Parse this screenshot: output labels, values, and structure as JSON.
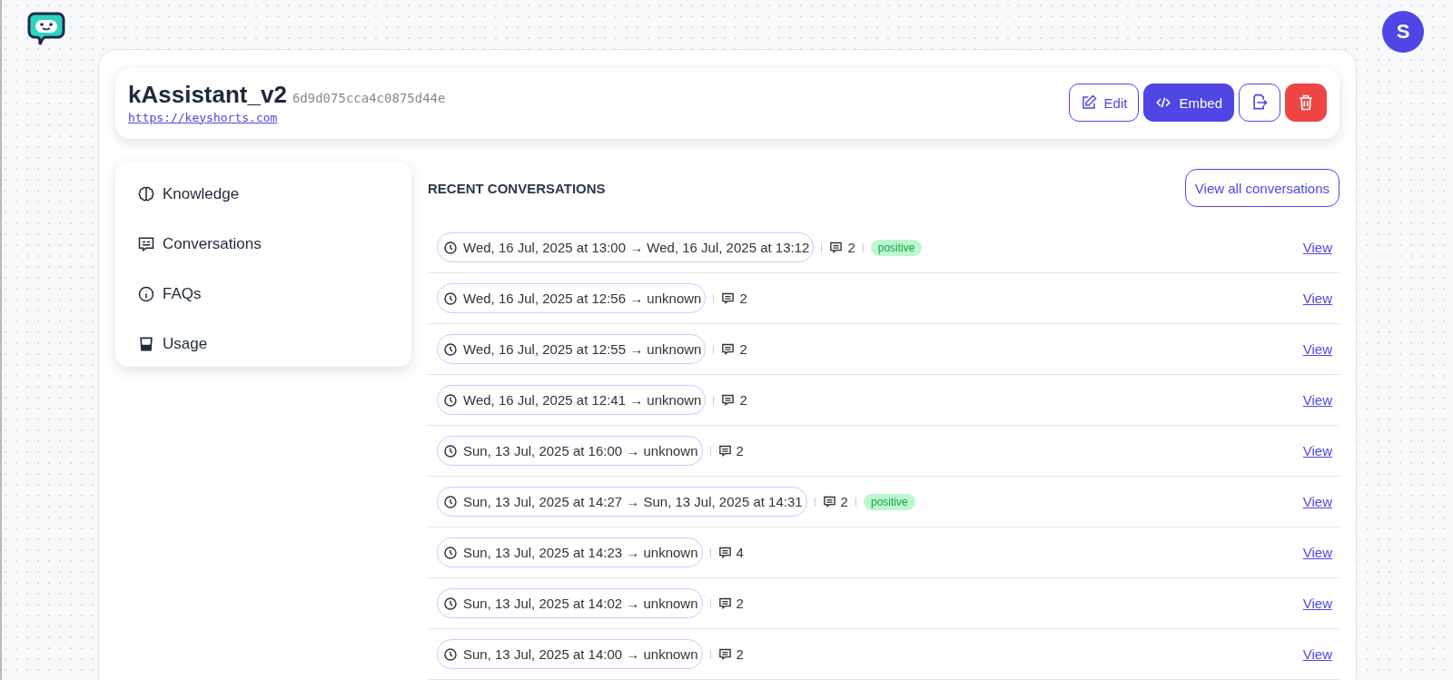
{
  "avatar": {
    "initial": "S"
  },
  "bot": {
    "name": "kAssistant_v2",
    "id": "6d9d075cca4c0875d44e",
    "url": "https://keyshorts.com"
  },
  "actions": [
    {
      "kind": "edit",
      "label": "Edit"
    },
    {
      "kind": "embed",
      "label": "Embed"
    },
    {
      "kind": "export"
    },
    {
      "kind": "delete"
    }
  ],
  "sidebar": {
    "items": [
      {
        "kind": "brain",
        "label": "Knowledge"
      },
      {
        "kind": "chat",
        "label": "Conversations"
      },
      {
        "kind": "info",
        "label": "FAQs"
      },
      {
        "kind": "usage",
        "label": "Usage"
      }
    ]
  },
  "recent": {
    "title": "RECENT CONVERSATIONS",
    "view_all": "View all conversations",
    "rows": [
      {
        "period": "Wed, 16 Jul, 2025 at 13:00 → Wed, 16 Jul, 2025 at 13:12",
        "messages": "2",
        "sentiment": "positive",
        "link": "View"
      },
      {
        "period": "Wed, 16 Jul, 2025 at 12:56 → unknown",
        "messages": "2",
        "link": "View"
      },
      {
        "period": "Wed, 16 Jul, 2025 at 12:55 → unknown",
        "messages": "2",
        "link": "View"
      },
      {
        "period": "Wed, 16 Jul, 2025 at 12:41 → unknown",
        "messages": "2",
        "link": "View"
      },
      {
        "period": "Sun, 13 Jul, 2025 at 16:00 → unknown",
        "messages": "2",
        "link": "View"
      },
      {
        "period": "Sun, 13 Jul, 2025 at 14:27 → Sun, 13 Jul, 2025 at 14:31",
        "messages": "2",
        "sentiment": "positive",
        "link": "View"
      },
      {
        "period": "Sun, 13 Jul, 2025 at 14:23 → unknown",
        "messages": "4",
        "link": "View"
      },
      {
        "period": "Sun, 13 Jul, 2025 at 14:02 → unknown",
        "messages": "2",
        "link": "View"
      },
      {
        "period": "Sun, 13 Jul, 2025 at 14:00 → unknown",
        "messages": "2",
        "link": "View"
      }
    ]
  }
}
